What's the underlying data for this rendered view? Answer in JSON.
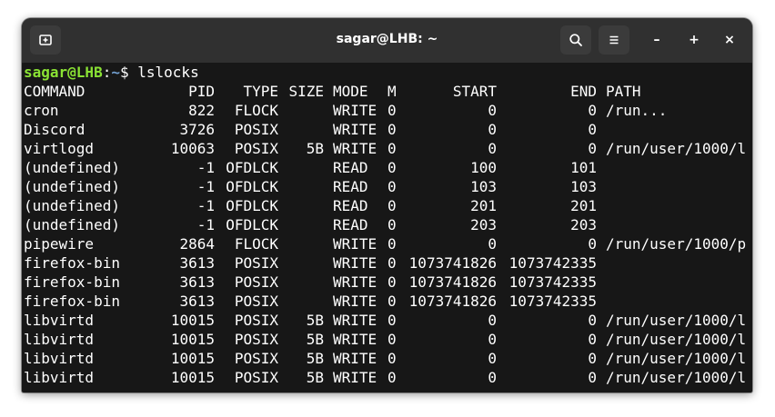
{
  "titlebar": {
    "title": "sagar@LHB: ~",
    "new_tab_icon": "new-tab-icon",
    "search_icon": "search-icon",
    "menu_icon": "hamburger-menu-icon",
    "minimize_label": "–",
    "maximize_label": "+",
    "close_label": "×"
  },
  "prompt": {
    "user_host": "sagar@LHB",
    "separator": ":",
    "path": "~",
    "symbol": "$",
    "command": "lslocks"
  },
  "table": {
    "headers": [
      "COMMAND",
      "PID",
      "TYPE",
      "SIZE",
      "MODE",
      "M",
      "START",
      "END",
      "PATH"
    ],
    "rows": [
      [
        "cron",
        "822",
        "FLOCK",
        "",
        "WRITE",
        "0",
        "0",
        "0",
        "/run..."
      ],
      [
        "Discord",
        "3726",
        "POSIX",
        "",
        "WRITE",
        "0",
        "0",
        "0",
        ""
      ],
      [
        "virtlogd",
        "10063",
        "POSIX",
        "5B",
        "WRITE",
        "0",
        "0",
        "0",
        "/run/user/1000/l"
      ],
      [
        "(undefined)",
        "-1",
        "OFDLCK",
        "",
        "READ",
        "0",
        "100",
        "101",
        ""
      ],
      [
        "(undefined)",
        "-1",
        "OFDLCK",
        "",
        "READ",
        "0",
        "103",
        "103",
        ""
      ],
      [
        "(undefined)",
        "-1",
        "OFDLCK",
        "",
        "READ",
        "0",
        "201",
        "201",
        ""
      ],
      [
        "(undefined)",
        "-1",
        "OFDLCK",
        "",
        "READ",
        "0",
        "203",
        "203",
        ""
      ],
      [
        "pipewire",
        "2864",
        "FLOCK",
        "",
        "WRITE",
        "0",
        "0",
        "0",
        "/run/user/1000/p"
      ],
      [
        "firefox-bin",
        "3613",
        "POSIX",
        "",
        "WRITE",
        "0",
        "1073741826",
        "1073742335",
        ""
      ],
      [
        "firefox-bin",
        "3613",
        "POSIX",
        "",
        "WRITE",
        "0",
        "1073741826",
        "1073742335",
        ""
      ],
      [
        "firefox-bin",
        "3613",
        "POSIX",
        "",
        "WRITE",
        "0",
        "1073741826",
        "1073742335",
        ""
      ],
      [
        "libvirtd",
        "10015",
        "POSIX",
        "5B",
        "WRITE",
        "0",
        "0",
        "0",
        "/run/user/1000/l"
      ],
      [
        "libvirtd",
        "10015",
        "POSIX",
        "5B",
        "WRITE",
        "0",
        "0",
        "0",
        "/run/user/1000/l"
      ],
      [
        "libvirtd",
        "10015",
        "POSIX",
        "5B",
        "WRITE",
        "0",
        "0",
        "0",
        "/run/user/1000/l"
      ],
      [
        "libvirtd",
        "10015",
        "POSIX",
        "5B",
        "WRITE",
        "0",
        "0",
        "0",
        "/run/user/1000/l"
      ]
    ]
  },
  "colors": {
    "prompt_user": "#8ae234",
    "prompt_path": "#729fcf",
    "terminal_bg": "#171717",
    "titlebar_bg": "#303030"
  }
}
